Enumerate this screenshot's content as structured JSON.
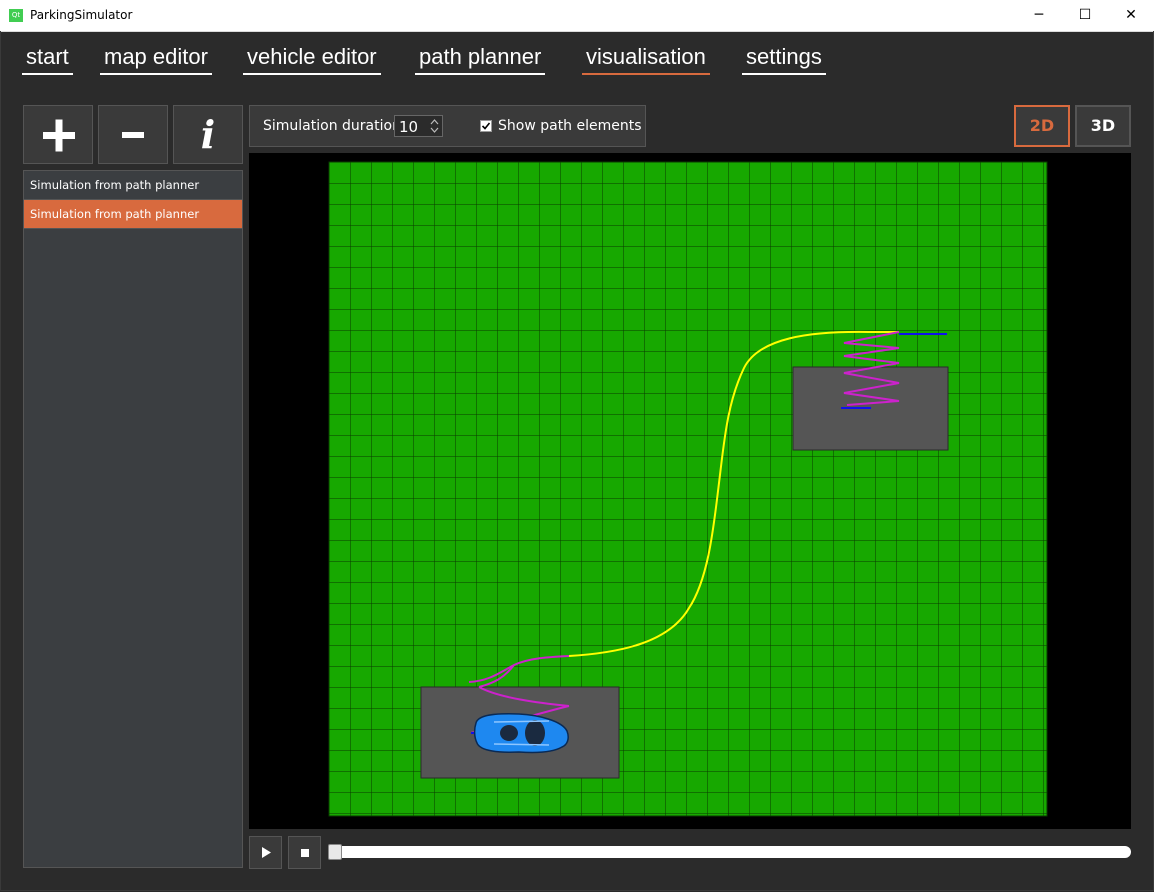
{
  "window": {
    "title": "ParkingSimulator",
    "app_icon_text": "Qt",
    "minimize_glyph": "─",
    "maximize_glyph": "☐",
    "close_glyph": "✕"
  },
  "tabs": [
    {
      "label": "start",
      "active": false
    },
    {
      "label": "map editor",
      "active": false
    },
    {
      "label": "vehicle editor",
      "active": false
    },
    {
      "label": "path planner",
      "active": false
    },
    {
      "label": "visualisation",
      "active": true
    },
    {
      "label": "settings",
      "active": false
    }
  ],
  "side_buttons": {
    "add_icon": "plus-icon",
    "remove_icon": "minus-icon",
    "info_icon": "info-icon",
    "info_glyph": "i"
  },
  "simulations": [
    {
      "label": "Simulation from path planner",
      "selected": false
    },
    {
      "label": "Simulation from path planner",
      "selected": true
    }
  ],
  "toolbar": {
    "duration_label": "Simulation duration",
    "duration_value": "10",
    "show_path_label": "Show path elements",
    "show_path_checked": true
  },
  "view_mode": {
    "btn_2d": "2D",
    "btn_3d": "3D",
    "active": "2D"
  },
  "playback": {
    "play_icon": "play-icon",
    "stop_icon": "stop-icon",
    "progress": 0.0
  },
  "colors": {
    "accent": "#d86a3e",
    "grass": "#17a800",
    "grid_line": "#0a3a00",
    "parking_spot": "#555555",
    "path_main": "#ffff00",
    "path_arc": "#cc22cc",
    "path_segment": "#1111ee",
    "vehicle": "#1e88f0"
  }
}
